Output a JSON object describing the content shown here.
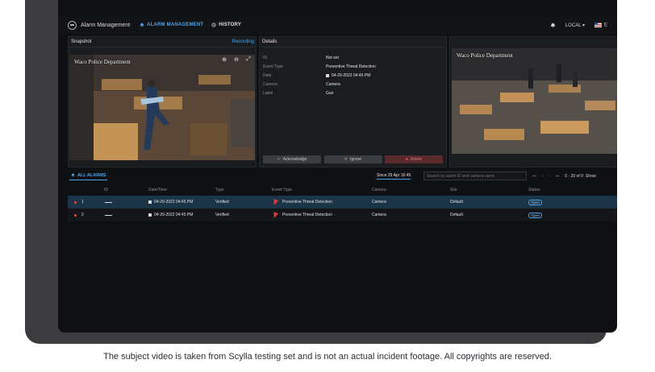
{
  "app": {
    "title": "Alarm Management",
    "nav": [
      {
        "label": "ALARM MANAGEMENT",
        "icon": "bell-icon",
        "active": true
      },
      {
        "label": "HISTORY",
        "icon": "history-icon",
        "active": false
      }
    ],
    "location": "LOCAL",
    "language": "E"
  },
  "snapshot": {
    "title": "Snapshot",
    "recording_label": "Recording",
    "watermark": "Waco Police Department"
  },
  "details": {
    "title": "Details",
    "rows": [
      {
        "label": "ID",
        "value": "Not set"
      },
      {
        "label": "Event Type",
        "value": "Preventive Threat Detection"
      },
      {
        "label": "Date",
        "value": "04-29-2022 04:45 PM"
      },
      {
        "label": "Camera",
        "value": "Camera"
      },
      {
        "label": "Label",
        "value": "Gun"
      }
    ],
    "actions": {
      "acknowledge": "Acknowledge",
      "ignore": "Ignore",
      "delete": "Delete"
    }
  },
  "live": {
    "watermark": "Waco Police Department"
  },
  "alarms": {
    "tab_label": "ALL ALARMS",
    "since": "Since 29 Apr 16:45",
    "search_placeholder": "Search by alarm ID and camera name",
    "pagination": "0 - 20 of 0",
    "show_label": "Show:",
    "columns": [
      "ID",
      "Date/Time",
      "Type",
      "Event Type",
      "Camera",
      "Site",
      "Status"
    ],
    "rows": [
      {
        "index": "1",
        "datetime": "04-29-2022 04:45 PM",
        "type": "Verified",
        "event_type": "Preventive Threat Detection",
        "camera": "Camera",
        "site": "Default",
        "status": "Open"
      },
      {
        "index": "2",
        "datetime": "04-29-2022 04:45 PM",
        "type": "Verified",
        "event_type": "Preventive Threat Detection",
        "camera": "Camera",
        "site": "Default",
        "status": "Open"
      }
    ]
  },
  "caption": "The subject video is taken from Scylla testing set and is not an actual incident footage. All copyrights are reserved.",
  "colors": {
    "accent": "#4ea2e6",
    "alert": "#e04a4a",
    "selected_row": "#1c3448",
    "panel": "#1b1c20"
  }
}
